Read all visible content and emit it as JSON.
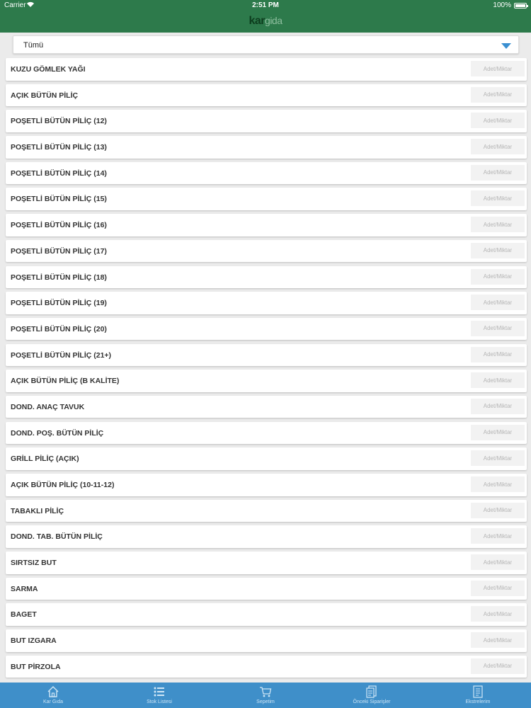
{
  "status": {
    "carrier": "Carrier",
    "time": "2:51 PM",
    "battery": "100%"
  },
  "header": {
    "logo_k": "kar",
    "logo_rest": "gida"
  },
  "filter": {
    "selected": "Tümü"
  },
  "quantity_placeholder": "Adet/Miktar",
  "products": [
    "KUZU GÖMLEK YAĞI",
    "AÇIK BÜTÜN PİLİÇ",
    "POŞETLİ BÜTÜN PİLİÇ (12)",
    "POŞETLİ BÜTÜN PİLİÇ (13)",
    "POŞETLİ BÜTÜN PİLİÇ (14)",
    "POŞETLİ BÜTÜN PİLİÇ (15)",
    "POŞETLİ BÜTÜN PİLİÇ (16)",
    "POŞETLİ BÜTÜN PİLİÇ (17)",
    "POŞETLİ BÜTÜN PİLİÇ (18)",
    "POŞETLİ BÜTÜN PİLİÇ (19)",
    "POŞETLİ BÜTÜN PİLİÇ (20)",
    "POŞETLİ BÜTÜN PİLİÇ (21+)",
    "AÇIK BÜTÜN PİLİÇ (B KALİTE)",
    "DOND. ANAÇ TAVUK",
    "DOND. POŞ. BÜTÜN PİLİÇ",
    "GRİLL PİLİÇ (AÇIK)",
    "AÇIK BÜTÜN PİLİÇ (10-11-12)",
    "TABAKLI PİLİÇ",
    "DOND. TAB. BÜTÜN PİLİÇ",
    "SIRTSIZ BUT",
    "SARMA",
    "BAGET",
    "BUT IZGARA",
    "BUT PİRZOLA"
  ],
  "tabs": [
    {
      "label": "Kar Gıda",
      "icon": "home-icon"
    },
    {
      "label": "Stok Listesi",
      "icon": "list-icon"
    },
    {
      "label": "Sepetim",
      "icon": "cart-icon"
    },
    {
      "label": "Önceki Siparişler",
      "icon": "orders-icon"
    },
    {
      "label": "Ekstrelerim",
      "icon": "statement-icon"
    }
  ]
}
